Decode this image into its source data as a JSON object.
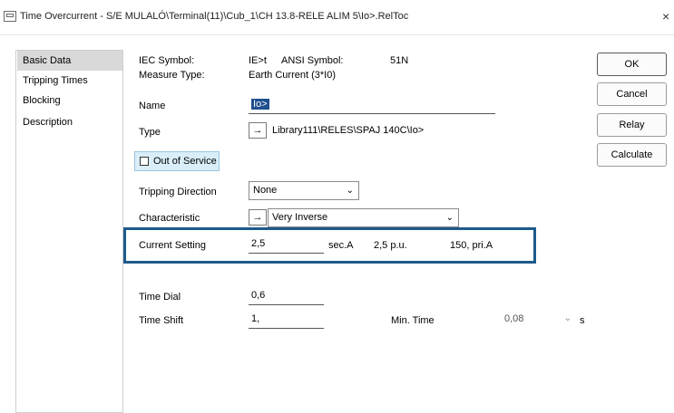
{
  "window": {
    "title": "Time Overcurrent - S/E MULALÓ\\Terminal(11)\\Cub_1\\CH 13.8-RELE ALIM 5\\Io>.RelToc",
    "close_glyph": "×"
  },
  "sidebar": {
    "items": [
      {
        "label": "Basic Data"
      },
      {
        "label": "Tripping Times"
      },
      {
        "label": "Blocking"
      },
      {
        "label": "Description"
      }
    ]
  },
  "buttons": {
    "ok": "OK",
    "cancel": "Cancel",
    "relay": "Relay",
    "calculate": "Calculate"
  },
  "info": {
    "iec_label": "IEC Symbol:",
    "iec_value": "IE>t",
    "ansi_label": "ANSI Symbol:",
    "ansi_value": "51N",
    "measure_label": "Measure Type:",
    "measure_value": "Earth Current (3*I0)"
  },
  "form": {
    "name_label": "Name",
    "name_value": "Io>",
    "type_label": "Type",
    "type_arrow": "→",
    "type_value": "Library111\\RELES\\SPAJ 140C\\Io>",
    "out_of_service_label": "Out of Service",
    "out_of_service_checked": false,
    "tripping_direction_label": "Tripping Direction",
    "tripping_direction_value": "None",
    "characteristic_label": "Characteristic",
    "characteristic_arrow": "→",
    "characteristic_value": "Very Inverse",
    "current_setting_label": "Current Setting",
    "current_setting_value": "2,5",
    "current_setting_unit": "sec.A",
    "current_pu": "2,5 p.u.",
    "current_pri": "150, pri.A",
    "time_dial_label": "Time Dial",
    "time_dial_value": "0,6",
    "time_shift_label": "Time Shift",
    "time_shift_value": "1,",
    "min_time_label": "Min. Time",
    "min_time_value": "0,08",
    "min_time_unit": "s"
  },
  "colors": {
    "highlight_border": "#1e5a8c",
    "name_highlight_bg": "#1f4f8f",
    "oos_bg": "#d9eef8"
  }
}
